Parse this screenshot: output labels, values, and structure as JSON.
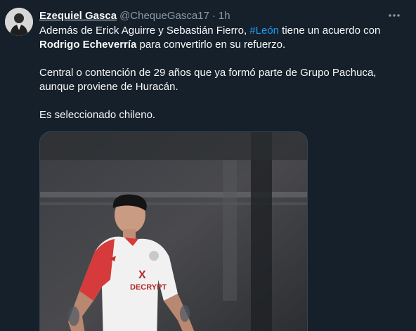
{
  "tweet": {
    "author_name": "Ezequiel Gasca",
    "author_handle": "@ChequeGasca17",
    "separator": "·",
    "time": "1h",
    "more_icon": "ellipsis-icon",
    "paragraphs": {
      "p1_before": "Además de Erick Aguirre y Sebastián Fierro, ",
      "p1_hashtag": "#León",
      "p1_after": " tiene un acuerdo con",
      "p1_bold": "Rodrigo Echeverría",
      "p1_end": " para convertirlo en su refuerzo.",
      "p2": "Central o contención de 29 años que ya formó parte de Grupo Pachuca, aunque proviene de Huracán.",
      "p3": "Es seleccionado chileno."
    },
    "media": {
      "shirt_sponsor": "DECRYPT"
    }
  },
  "colors": {
    "background": "#15202b",
    "text": "#f7f9f9",
    "secondary": "#8b98a5",
    "link": "#1d9bf0"
  }
}
